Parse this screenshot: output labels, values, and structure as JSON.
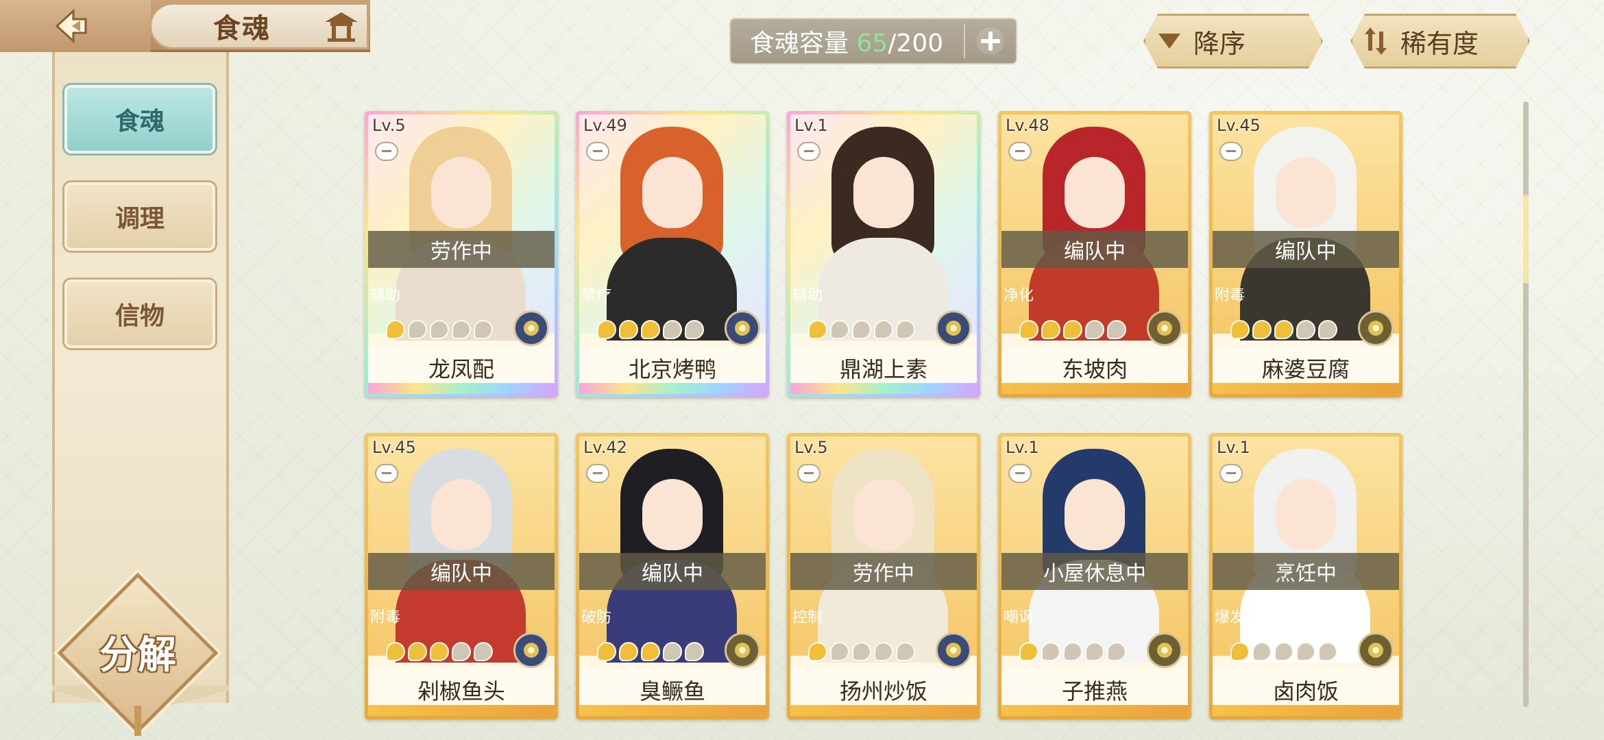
{
  "header": {
    "title": "食魂"
  },
  "sidebar": {
    "tabs": [
      {
        "label": "食魂",
        "active": true
      },
      {
        "label": "调理",
        "active": false
      },
      {
        "label": "信物",
        "active": false
      }
    ],
    "decompose_label": "分解"
  },
  "capacity": {
    "label": "食魂容量",
    "current": "65",
    "sep": "/",
    "max": "200"
  },
  "sort": {
    "order_label": "降序",
    "rarity_label": "稀有度"
  },
  "colors": {
    "accent_teal": "#8fd0cc",
    "gold": "#f2c664",
    "capacity_current": "#8fe39a"
  },
  "cards": [
    {
      "level": "Lv.5",
      "status": "劳作中",
      "role": "辅助",
      "name": "龙凤配",
      "stars": 1,
      "rarity": "rainbow",
      "element": "blue"
    },
    {
      "level": "Lv.49",
      "status": "",
      "role": "禁疗",
      "name": "北京烤鸭",
      "stars": 3,
      "rarity": "rainbow",
      "element": "blue"
    },
    {
      "level": "Lv.1",
      "status": "",
      "role": "辅助",
      "name": "鼎湖上素",
      "stars": 1,
      "rarity": "rainbow",
      "element": "blue"
    },
    {
      "level": "Lv.48",
      "status": "编队中",
      "role": "净化",
      "name": "东坡肉",
      "stars": 3,
      "rarity": "gold",
      "element": "gold"
    },
    {
      "level": "Lv.45",
      "status": "编队中",
      "role": "附毒",
      "name": "麻婆豆腐",
      "stars": 3,
      "rarity": "gold",
      "element": "gold"
    },
    {
      "level": "Lv.45",
      "status": "编队中",
      "role": "附毒",
      "name": "剁椒鱼头",
      "stars": 3,
      "rarity": "gold",
      "element": "blue"
    },
    {
      "level": "Lv.42",
      "status": "编队中",
      "role": "破防",
      "name": "臭鳜鱼",
      "stars": 3,
      "rarity": "gold",
      "element": "gold"
    },
    {
      "level": "Lv.5",
      "status": "劳作中",
      "role": "控制",
      "name": "扬州炒饭",
      "stars": 1,
      "rarity": "gold",
      "element": "blue"
    },
    {
      "level": "Lv.1",
      "status": "小屋休息中",
      "role": "嘲讽",
      "name": "子推燕",
      "stars": 1,
      "rarity": "gold",
      "element": "gold"
    },
    {
      "level": "Lv.1",
      "status": "烹饪中",
      "role": "爆发",
      "name": "卤肉饭",
      "stars": 1,
      "rarity": "gold",
      "element": "gold"
    }
  ]
}
